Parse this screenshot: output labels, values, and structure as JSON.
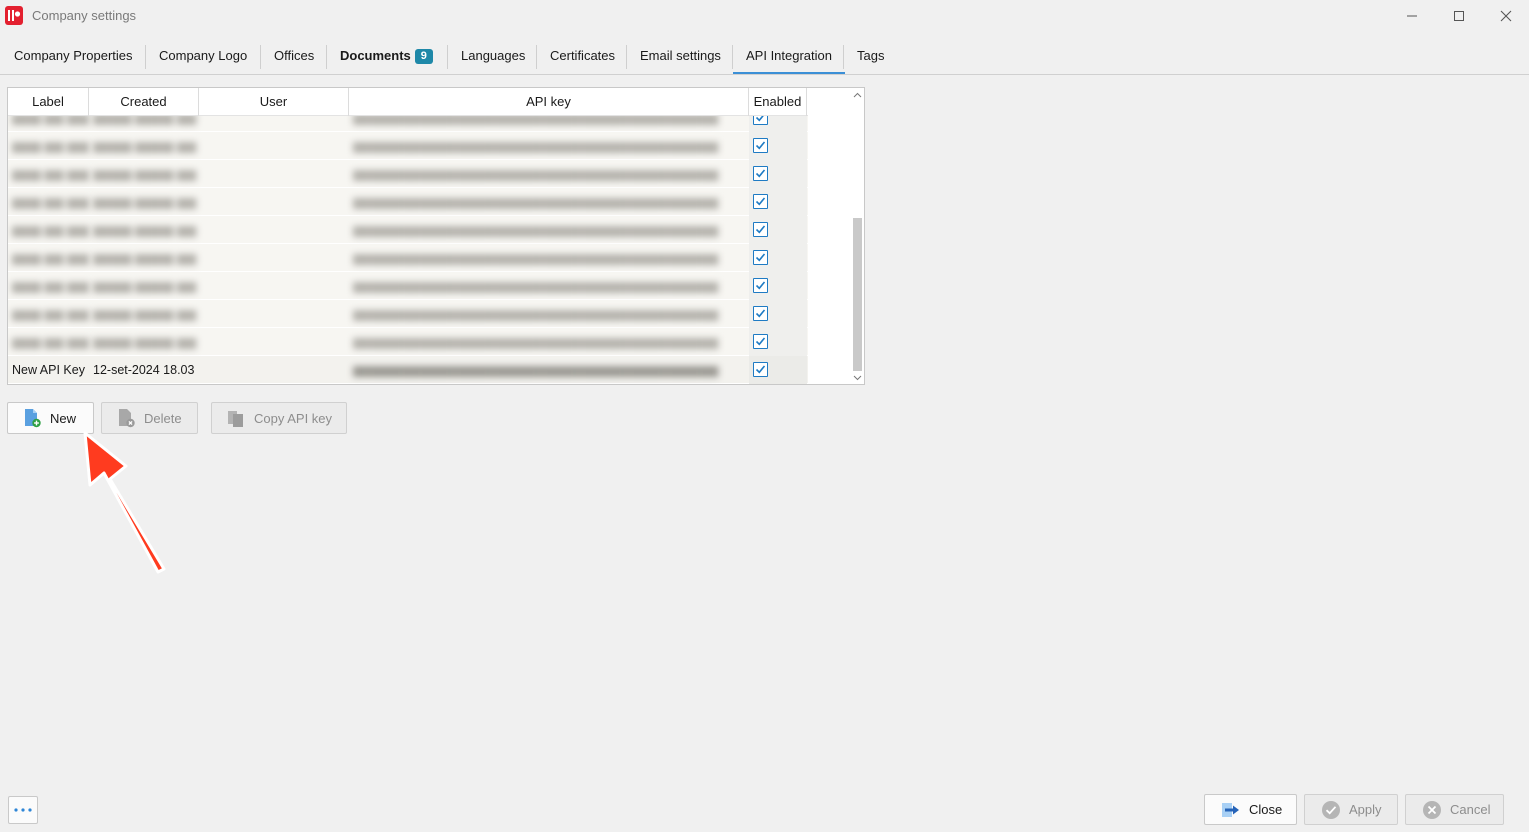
{
  "window": {
    "title": "Company settings"
  },
  "tabs": [
    {
      "label": "Company Properties"
    },
    {
      "label": "Company Logo"
    },
    {
      "label": "Offices"
    },
    {
      "label": "Documents",
      "badge": "9"
    },
    {
      "label": "Languages"
    },
    {
      "label": "Certificates"
    },
    {
      "label": "Email settings"
    },
    {
      "label": "API Integration"
    },
    {
      "label": "Tags"
    }
  ],
  "active_tab": "API Integration",
  "grid": {
    "columns": [
      "Label",
      "Created",
      "User",
      "API key",
      "Enabled"
    ],
    "rows": [
      {
        "label": "New API Key",
        "created": "12-set-2024 18.03",
        "api_key": "",
        "enabled": true
      }
    ],
    "hidden_rows_note": ""
  },
  "actions": {
    "new_label": "New",
    "delete_label": "Delete",
    "copy_label": "Copy API key"
  },
  "footer": {
    "close_label": "Close",
    "apply_label": "Apply",
    "cancel_label": "Cancel"
  },
  "colors": {
    "accent": "#3b8fd6",
    "badge": "#1e88a8",
    "arrow": "#ff3b1f",
    "logo": "#e3202f"
  }
}
